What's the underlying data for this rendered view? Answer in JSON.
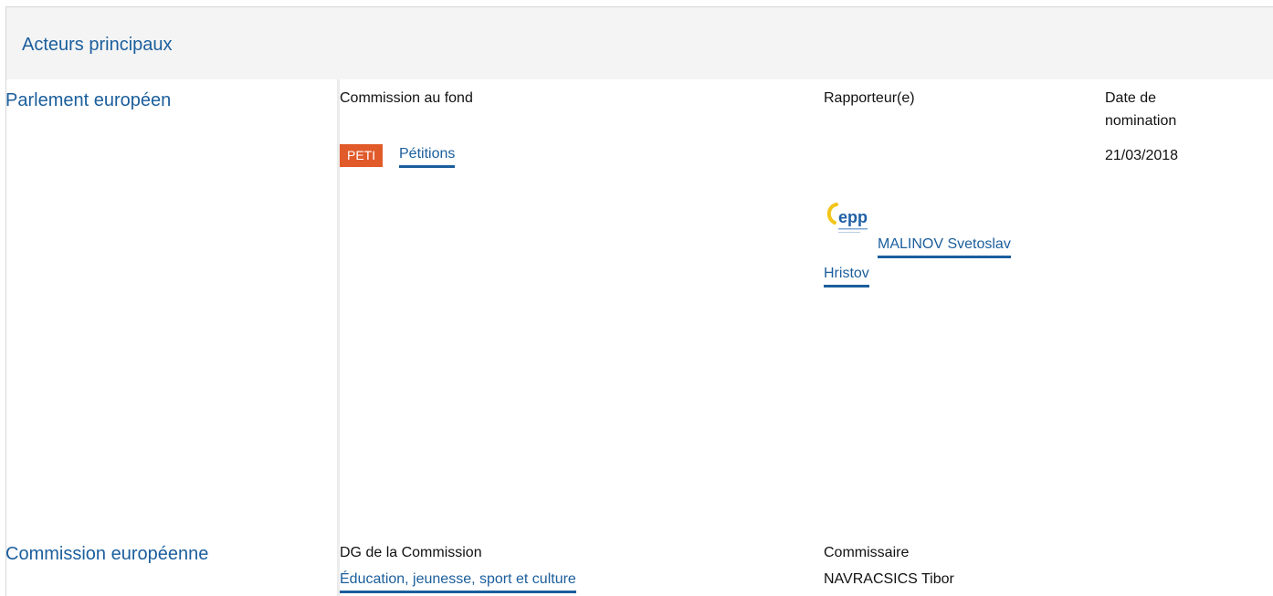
{
  "section": {
    "title": "Acteurs principaux"
  },
  "parliament": {
    "name": "Parlement européen",
    "col_committee_header": "Commission au fond",
    "col_rapporteur_header": "Rapporteur(e)",
    "col_date_header_line1": "Date de",
    "col_date_header_line2": "nomination",
    "committee_badge": "PETI",
    "committee_name": "Pétitions",
    "appointment_date": "21/03/2018",
    "rapporteur_name_line1": "MALINOV Svetoslav",
    "rapporteur_name_line2": "Hristov",
    "group_logo_text": "epp",
    "group_logo_icon": "epp-group-logo"
  },
  "commission": {
    "name": "Commission européenne",
    "col_dg_header": "DG de la Commission",
    "col_commissioner_header": "Commissaire",
    "dg_name": "Éducation, jeunesse, sport et culture",
    "commissioner_name": "NAVRACSICS Tibor"
  },
  "colors": {
    "accent": "#1b5e9c",
    "badge": "#e15a2a",
    "header_bg": "#f4f4f4"
  }
}
